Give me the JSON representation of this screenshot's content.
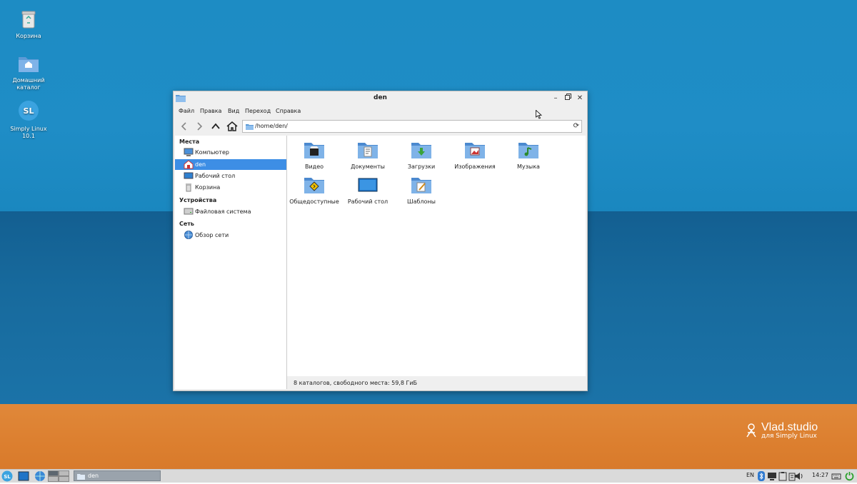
{
  "desktop": {
    "icons": [
      {
        "label": "Корзина"
      },
      {
        "label": "Домашний каталог"
      },
      {
        "label": "Simply Linux 10.1"
      }
    ],
    "watermark": {
      "title": "Vlad.studio",
      "subtitle": "для Simply Linux"
    }
  },
  "window": {
    "title": "den",
    "menu": [
      "Файл",
      "Правка",
      "Вид",
      "Переход",
      "Справка"
    ],
    "address": "/home/den/",
    "sidebar": {
      "places_header": "Места",
      "places": [
        {
          "label": "Компьютер",
          "icon": "computer-icon"
        },
        {
          "label": "den",
          "icon": "home-icon",
          "selected": true
        },
        {
          "label": "Рабочий стол",
          "icon": "desktop-icon"
        },
        {
          "label": "Корзина",
          "icon": "trash-icon"
        }
      ],
      "devices_header": "Устройства",
      "devices": [
        {
          "label": "Файловая система",
          "icon": "drive-icon"
        }
      ],
      "network_header": "Сеть",
      "network": [
        {
          "label": "Обзор сети",
          "icon": "network-icon"
        }
      ]
    },
    "files": [
      {
        "label": "Видео",
        "icon": "folder-video-icon"
      },
      {
        "label": "Документы",
        "icon": "folder-documents-icon"
      },
      {
        "label": "Загрузки",
        "icon": "folder-downloads-icon"
      },
      {
        "label": "Изображения",
        "icon": "folder-pictures-icon"
      },
      {
        "label": "Музыка",
        "icon": "folder-music-icon"
      },
      {
        "label": "Общедоступные",
        "icon": "folder-public-icon"
      },
      {
        "label": "Рабочий стол",
        "icon": "folder-desktop-icon"
      },
      {
        "label": "Шаблоны",
        "icon": "folder-templates-icon"
      }
    ],
    "status": "8 каталогов, свободного места: 59,8 ГиБ"
  },
  "panel": {
    "task_label": "den",
    "lang": "EN",
    "clock": "14:27"
  },
  "colors": {
    "accent": "#3d8ee5",
    "folder": "#6aa5e0"
  }
}
